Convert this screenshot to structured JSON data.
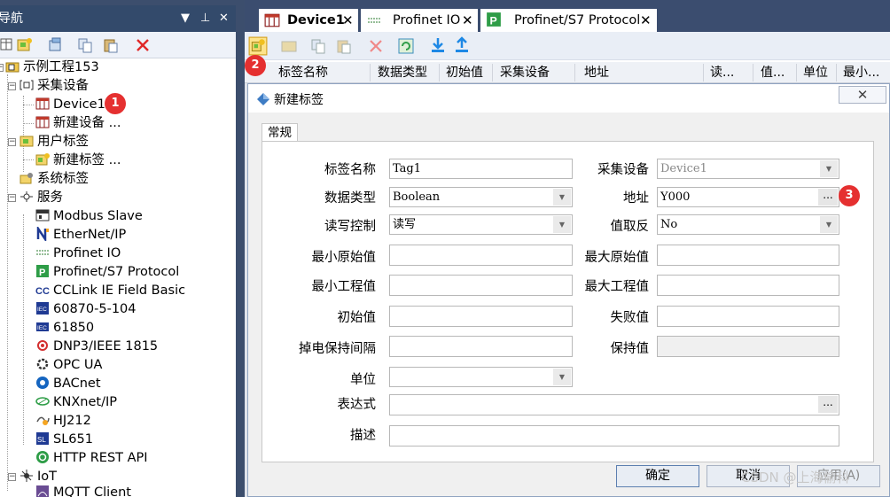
{
  "nav": {
    "title": "导航",
    "pin": "▼  ⊥  ✕",
    "tree": {
      "root": "示例工程153",
      "collect": "采集设备",
      "device1": "Device1",
      "new_device": "新建设备 ...",
      "user_tags": "用户标签",
      "new_tag": "新建标签 ...",
      "system_tags": "系统标签",
      "services": "服务",
      "modbus": "Modbus Slave",
      "ethernetip": "EtherNet/IP",
      "profinet": "Profinet IO",
      "profinet_s7": "Profinet/S7 Protocol",
      "cclink": "CCLink IE Field Basic",
      "iec104": "60870-5-104",
      "iec61850": "61850",
      "dnp3": "DNP3/IEEE 1815",
      "opcua": "OPC UA",
      "bacnet": "BACnet",
      "knx": "KNXnet/IP",
      "hj212": "HJ212",
      "sl651": "SL651",
      "http": "HTTP REST API",
      "iot": "IoT",
      "mqtt": "MQTT Client"
    }
  },
  "tabs": [
    {
      "label": "Device1"
    },
    {
      "label": "Profinet IO"
    },
    {
      "label": "Profinet/S7 Protocol"
    }
  ],
  "grid": {
    "columns": [
      "标签名称",
      "数据类型",
      "初始值",
      "采集设备",
      "地址",
      "读...",
      "值...",
      "单位",
      "最小..."
    ]
  },
  "dialog": {
    "title": "新建标签",
    "tab": "常规",
    "labels": {
      "tag_name": "标签名称",
      "data_type": "数据类型",
      "rw": "读写控制",
      "min_raw": "最小原始值",
      "min_eng": "最小工程值",
      "init": "初始值",
      "retain_interval": "掉电保持间隔",
      "unit": "单位",
      "expression": "表达式",
      "desc": "描述",
      "device": "采集设备",
      "address": "地址",
      "invert": "值取反",
      "max_raw": "最大原始值",
      "max_eng": "最大工程值",
      "fail": "失败值",
      "retain_value": "保持值"
    },
    "values": {
      "tag_name": "Tag1",
      "data_type": "Boolean",
      "rw": "读写",
      "device": "Device1",
      "address": "Y000",
      "invert": "No"
    },
    "ellipsis": "...",
    "ok": "确定",
    "cancel": "取消",
    "apply": "应用(A)"
  },
  "badges": [
    "1",
    "2",
    "3"
  ],
  "watermark": "CSDN @上海偷科"
}
